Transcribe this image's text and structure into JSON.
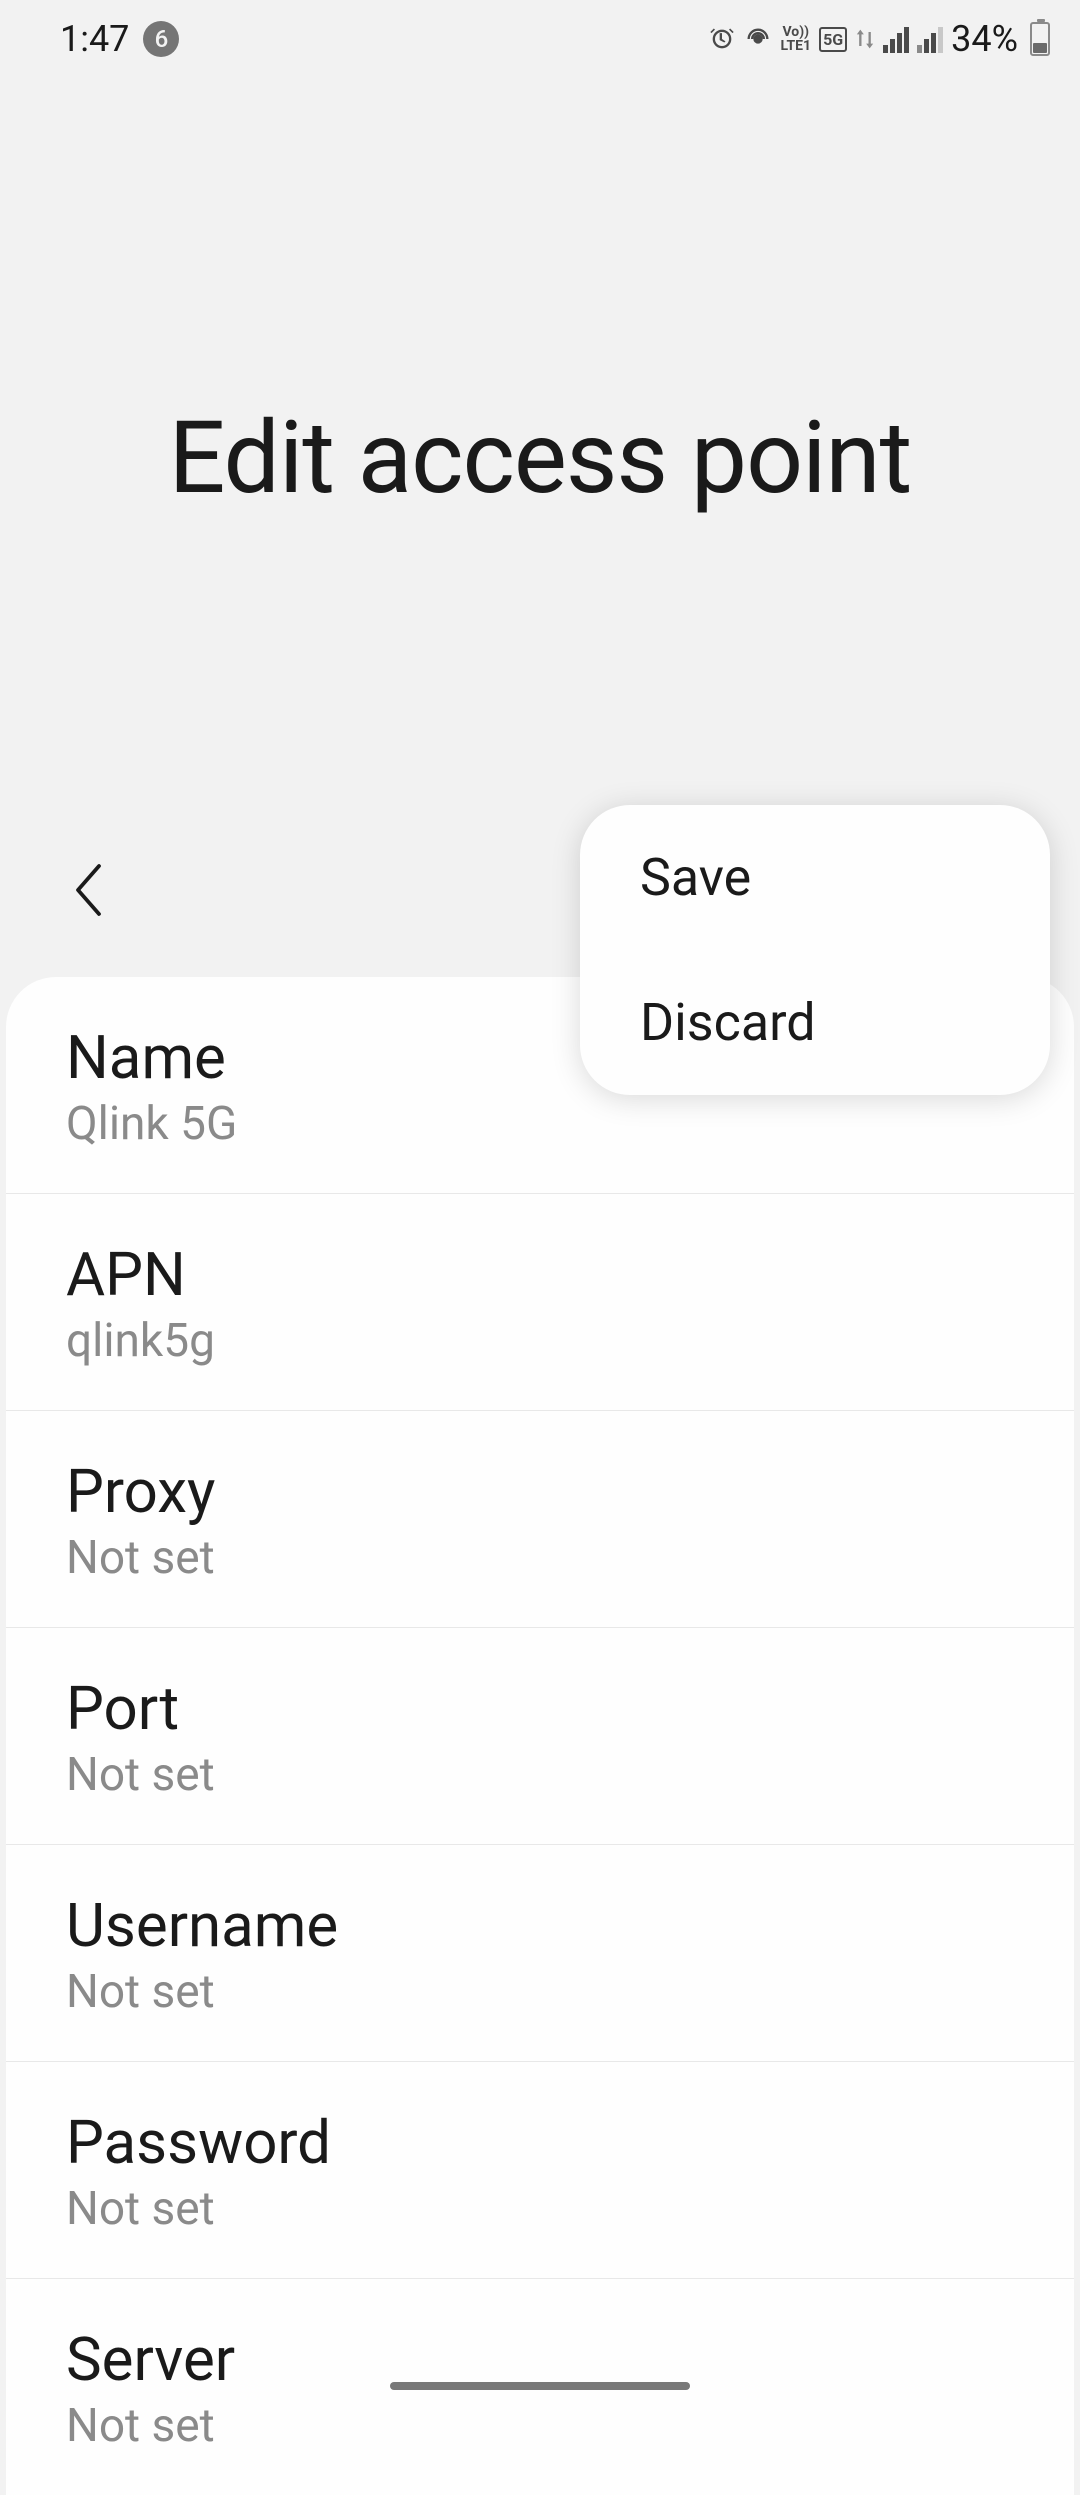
{
  "status_bar": {
    "time": "1:47",
    "notification_count": "6",
    "battery_percent": "34%",
    "lte_label": "Vo))",
    "lte_label2": "LTE1",
    "fiveg_label": "5G"
  },
  "page": {
    "title": "Edit access point"
  },
  "popup": {
    "save_label": "Save",
    "discard_label": "Discard"
  },
  "settings": [
    {
      "label": "Name",
      "value": "Qlink 5G"
    },
    {
      "label": "APN",
      "value": "qlink5g"
    },
    {
      "label": "Proxy",
      "value": "Not set"
    },
    {
      "label": "Port",
      "value": "Not set"
    },
    {
      "label": "Username",
      "value": "Not set"
    },
    {
      "label": "Password",
      "value": "Not set"
    },
    {
      "label": "Server",
      "value": "Not set"
    }
  ]
}
